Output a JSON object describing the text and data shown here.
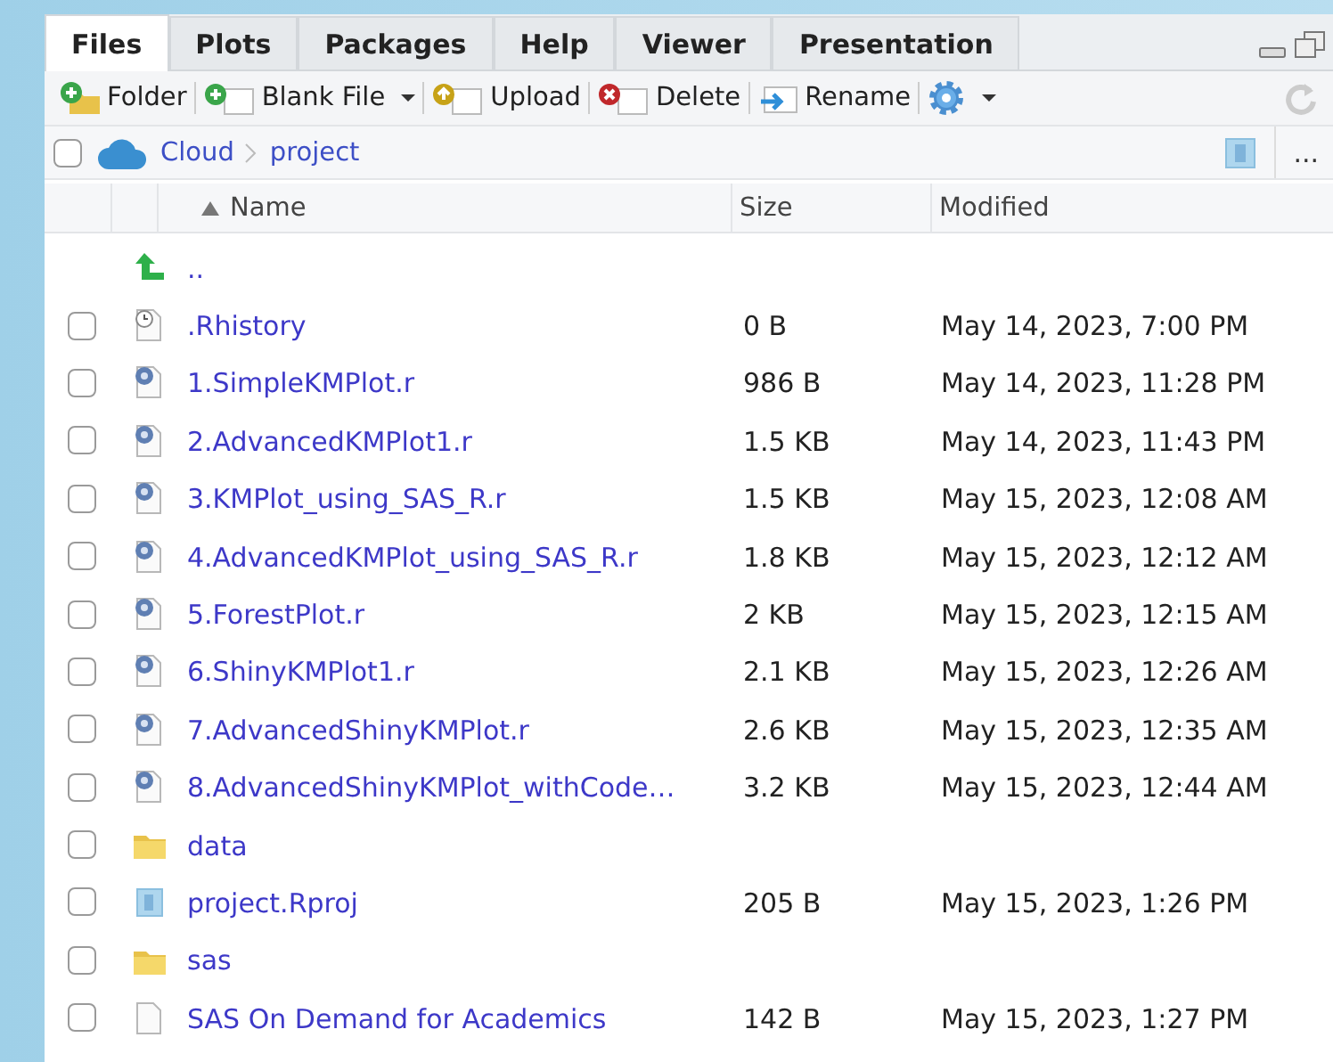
{
  "tabs": [
    {
      "label": "Files",
      "selected": true
    },
    {
      "label": "Plots",
      "selected": false
    },
    {
      "label": "Packages",
      "selected": false
    },
    {
      "label": "Help",
      "selected": false
    },
    {
      "label": "Viewer",
      "selected": false
    },
    {
      "label": "Presentation",
      "selected": false
    }
  ],
  "toolbar": [
    {
      "kind": "new-folder",
      "label": "Folder",
      "dropdown": false
    },
    {
      "kind": "new-file",
      "label": "Blank File",
      "dropdown": true
    },
    {
      "kind": "upload",
      "label": "Upload",
      "dropdown": false
    },
    {
      "kind": "delete",
      "label": "Delete",
      "dropdown": false
    },
    {
      "kind": "rename",
      "label": "Rename",
      "dropdown": false
    },
    {
      "kind": "more",
      "dropdown": true
    }
  ],
  "breadcrumb": {
    "checked": false,
    "items": [
      "Cloud",
      "project"
    ],
    "more": "..."
  },
  "table": {
    "columns": [
      "Name",
      "Size",
      "Modified"
    ],
    "rows": [
      {
        "kind": "parent",
        "name": ".."
      },
      {
        "kind": "history",
        "name": ".Rhistory",
        "size": "0 B",
        "modified": "May 14, 2023, 7:00 PM",
        "checked": false
      },
      {
        "kind": "rscript",
        "name": "1.SimpleKMPlot.r",
        "size": "986 B",
        "modified": "May 14, 2023, 11:28 PM",
        "checked": false
      },
      {
        "kind": "rscript",
        "name": "2.AdvancedKMPlot1.r",
        "size": "1.5 KB",
        "modified": "May 14, 2023, 11:43 PM",
        "checked": false
      },
      {
        "kind": "rscript",
        "name": "3.KMPlot_using_SAS_R.r",
        "size": "1.5 KB",
        "modified": "May 15, 2023, 12:08 AM",
        "checked": false
      },
      {
        "kind": "rscript",
        "name": "4.AdvancedKMPlot_using_SAS_R.r",
        "size": "1.8 KB",
        "modified": "May 15, 2023, 12:12 AM",
        "checked": false
      },
      {
        "kind": "rscript",
        "name": "5.ForestPlot.r",
        "size": "2 KB",
        "modified": "May 15, 2023, 12:15 AM",
        "checked": false
      },
      {
        "kind": "rscript",
        "name": "6.ShinyKMPlot1.r",
        "size": "2.1 KB",
        "modified": "May 15, 2023, 12:26 AM",
        "checked": false
      },
      {
        "kind": "rscript",
        "name": "7.AdvancedShinyKMPlot.r",
        "size": "2.6 KB",
        "modified": "May 15, 2023, 12:35 AM",
        "checked": false
      },
      {
        "kind": "rscript",
        "name": "8.AdvancedShinyKMPlot_withCode…",
        "size": "3.2 KB",
        "modified": "May 15, 2023, 12:44 AM",
        "checked": false
      },
      {
        "kind": "folder",
        "name": "data",
        "checked": false
      },
      {
        "kind": "rproj",
        "name": "project.Rproj",
        "size": "205 B",
        "modified": "May 15, 2023, 1:26 PM",
        "checked": false
      },
      {
        "kind": "folder",
        "name": "sas",
        "checked": false
      },
      {
        "kind": "blank",
        "name": "SAS On Demand for Academics",
        "size": "142 B",
        "modified": "May 15, 2023, 1:27 PM",
        "checked": false
      }
    ]
  }
}
